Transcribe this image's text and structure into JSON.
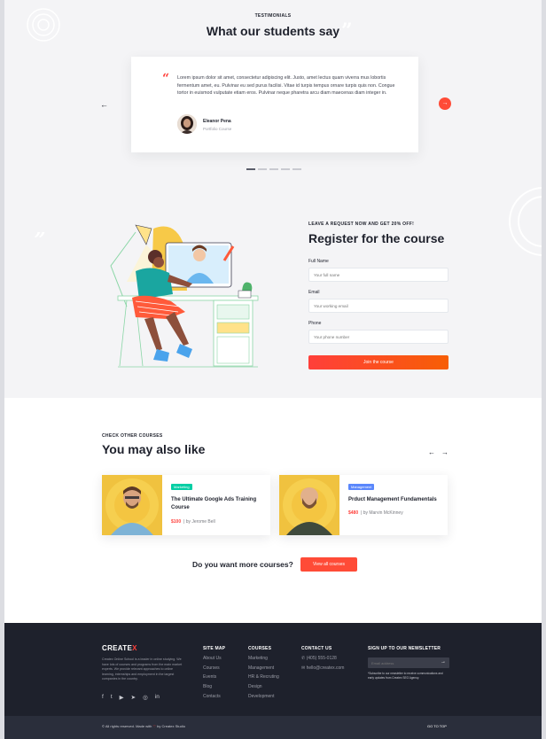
{
  "testimonials": {
    "eyebrow": "TESTIMONIALS",
    "title": "What our students say",
    "quote": "Lorem ipsum dolor sit amet, consectetur adipiscing elit. Justo, amet lectus quam viverra mus lobortis fermentum amet, eu. Pulvinar eu sed purus facilisi. Vitae id turpis tempus ornare turpis quis non. Congue tortor in euismod vulputate etiam eros. Pulvinar neque pharetra arcu diam maecenas diam integer in.",
    "author_name": "Eleanor Pena",
    "author_role": "Portfolio Course",
    "prev_icon": "arrow-left-icon",
    "next_icon": "arrow-right-icon",
    "dots_count": 5,
    "active_dot": 0
  },
  "register": {
    "eyebrow": "LEAVE A REQUEST NOW AND GET 20% OFF!",
    "title": "Register for the course",
    "full_name_label": "Full Name",
    "full_name_placeholder": "Your full name",
    "email_label": "Email",
    "email_placeholder": "Your working email",
    "phone_label": "Phone",
    "phone_placeholder": "Your phone number",
    "submit_label": "Join the course"
  },
  "courses": {
    "eyebrow": "CHECK OTHER COURSES",
    "title": "You may also like",
    "prev_arrow": "←",
    "next_arrow": "→",
    "items": [
      {
        "badge": "Marketing",
        "badge_color": "#03cea4",
        "title": "The Ultimate Google Ads Training Course",
        "price": "$100",
        "author": "| by Jerome Bell"
      },
      {
        "badge": "Management",
        "badge_color": "#5a87fc",
        "title": "Prduct Management Fundamentals",
        "price": "$480",
        "author": "| by Marvin McKinney"
      }
    ],
    "more_question": "Do you want more courses?",
    "view_all_label": "View all courses"
  },
  "footer": {
    "logo_text": "CREATE",
    "logo_accent": "X",
    "about": "Createx Online School is a leader in online studying. We have lots of courses and programs from the main market experts. We provide relevant approaches to online learning, internships and employment in the largest companies in the country.",
    "social_icons": [
      "facebook-icon",
      "twitter-icon",
      "youtube-icon",
      "telegram-icon",
      "instagram-icon",
      "linkedin-icon"
    ],
    "social_glyphs": [
      "f",
      "t",
      "▶",
      "➤",
      "◎",
      "in"
    ],
    "site_map_title": "SITE MAP",
    "site_map": [
      "About Us",
      "Courses",
      "Events",
      "Blog",
      "Contacts"
    ],
    "courses_title": "COURSES",
    "courses_links": [
      "Marketing",
      "Management",
      "HR & Recruting",
      "Design",
      "Development"
    ],
    "contact_title": "CONTACT US",
    "phone": "(405) 555-0128",
    "email": "hello@createx.com",
    "newsletter_title": "SIGN UP TO OUR NEWSLETTER",
    "newsletter_placeholder": "Email address",
    "newsletter_note": "*Subscribe to our newsletter to receive communications and early updates from Createx SEO Agency.",
    "copyright": "© All rights reserved. Made with",
    "copyright_tail": "by Createx Studio",
    "go_to_top": "GO TO TOP"
  }
}
